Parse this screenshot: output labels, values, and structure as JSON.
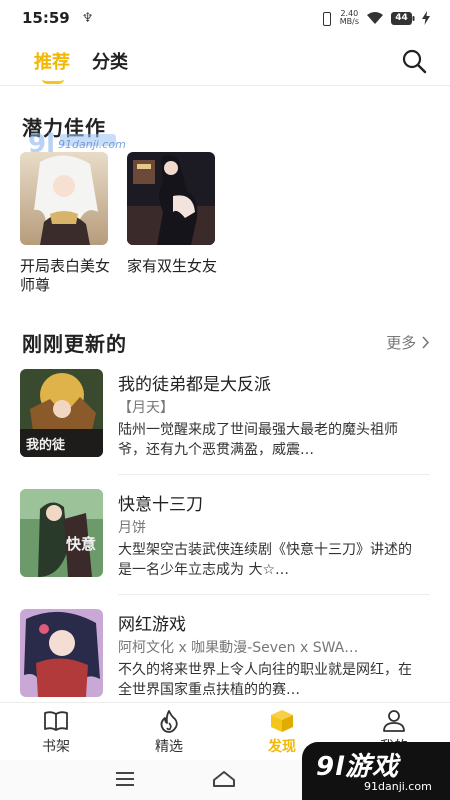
{
  "status_bar": {
    "time": "15:59",
    "usb_symbol": "♆",
    "net_speed_value": "2.40",
    "net_speed_unit": "MB/s",
    "battery_level": "44"
  },
  "top_nav": {
    "tabs": [
      {
        "label": "推荐",
        "active": true
      },
      {
        "label": "分类",
        "active": false
      }
    ],
    "search_icon": "search-icon"
  },
  "featured": {
    "title": "潜力佳作",
    "items": [
      {
        "title": "开局表白美女师尊"
      },
      {
        "title": "家有双生女友"
      }
    ]
  },
  "recent": {
    "title": "刚刚更新的",
    "more_label": "更多",
    "items": [
      {
        "title": "我的徒弟都是大反派",
        "author": "【月天】",
        "desc": "陆州一觉醒来成了世间最强大最老的魔头祖师爷，还有九个恶贯满盈，威震…"
      },
      {
        "title": "快意十三刀",
        "author": "月饼",
        "desc": "大型架空古装武侠连续剧《快意十三刀》讲述的是一名少年立志成为 大☆…"
      },
      {
        "title": "网红游戏",
        "author": "阿柯文化 x 咖果動漫-Seven x SWA…",
        "desc": "不久的将来世界上令人向往的职业就是网红，在全世界国家重点扶植的的赛…"
      }
    ]
  },
  "bottom_nav": {
    "items": [
      {
        "label": "书架",
        "icon": "book-icon",
        "active": false
      },
      {
        "label": "精选",
        "icon": "flame-icon",
        "active": false
      },
      {
        "label": "发现",
        "icon": "cube-icon",
        "active": true
      },
      {
        "label": "我的",
        "icon": "person-icon",
        "active": false
      }
    ]
  },
  "watermark": {
    "top_url": "91danji.com",
    "bottom_logo": "9l游戏",
    "bottom_url": "91danji.com"
  },
  "colors": {
    "accent": "#f2b705",
    "text": "#222222",
    "muted": "#777777"
  }
}
